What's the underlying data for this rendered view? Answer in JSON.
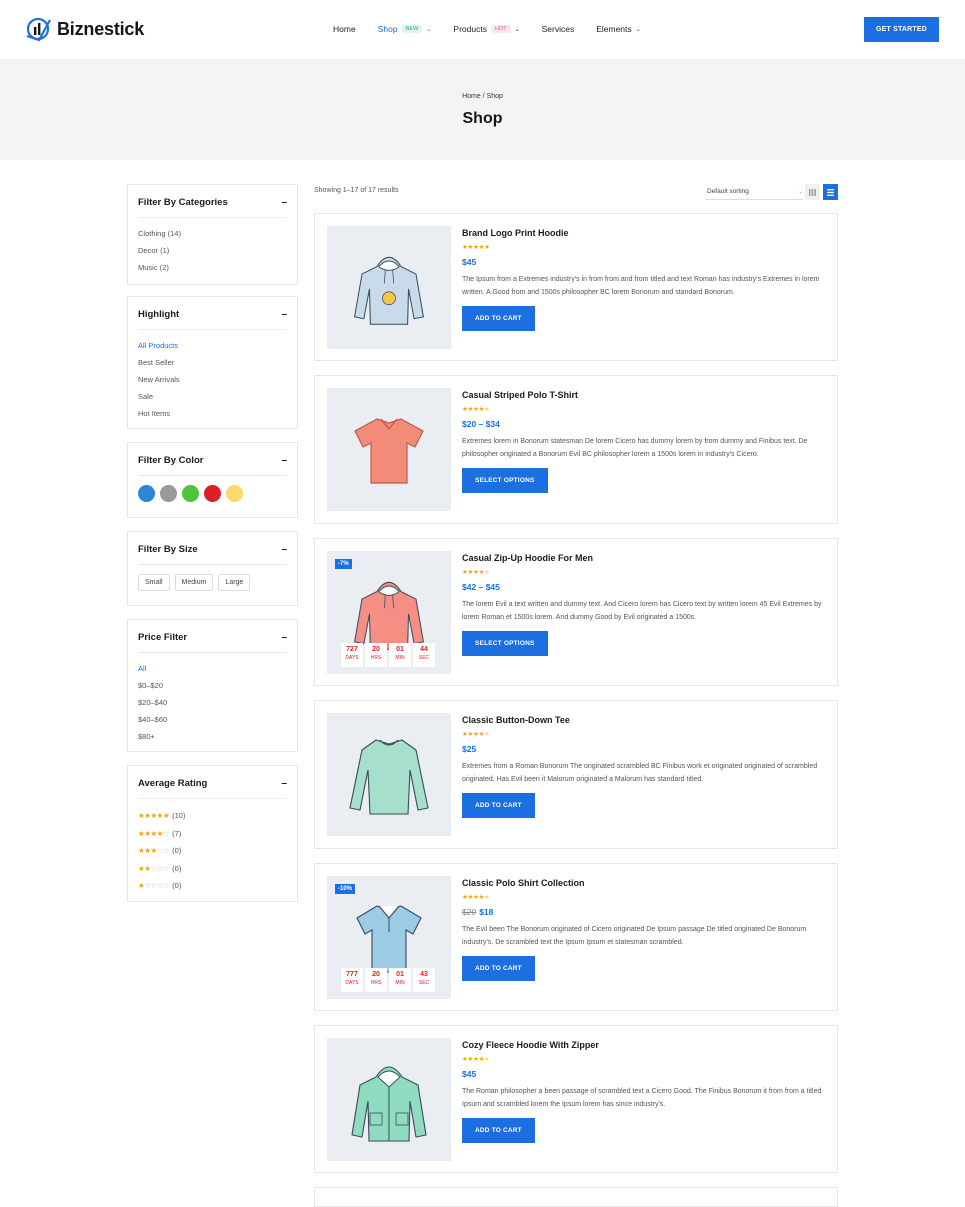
{
  "header": {
    "logo_text": "Biznestick",
    "nav": [
      {
        "label": "Home"
      },
      {
        "label": "Shop",
        "badge": "NEW"
      },
      {
        "label": "Products",
        "badge": "HOT"
      },
      {
        "label": "Services"
      },
      {
        "label": "Elements"
      }
    ],
    "cta_label": "GET STARTED"
  },
  "banner": {
    "breadcrumb": "Home / Shop",
    "title": "Shop"
  },
  "sidebar": {
    "categories": {
      "title": "Filter By Categories",
      "items": [
        "Clothing (14)",
        "Decor (1)",
        "Music (2)"
      ]
    },
    "highlight": {
      "title": "Highlight",
      "items": [
        "All Products",
        "Best Seller",
        "New Arrivals",
        "Sale",
        "Hot Items"
      ]
    },
    "color": {
      "title": "Filter By Color",
      "swatches": [
        "#2b86d6",
        "#999999",
        "#4cc63a",
        "#dc1f26",
        "#fdd86a"
      ]
    },
    "size": {
      "title": "Filter By Size",
      "items": [
        "Small",
        "Medium",
        "Large"
      ]
    },
    "price": {
      "title": "Price Filter",
      "items": [
        "All",
        "$0–$20",
        "$20–$40",
        "$40–$60",
        "$80+"
      ]
    },
    "rating": {
      "title": "Average Rating",
      "items": [
        {
          "stars": 5,
          "count": "(10)"
        },
        {
          "stars": 4,
          "count": "(7)"
        },
        {
          "stars": 3,
          "count": "(0)"
        },
        {
          "stars": 2,
          "count": "(0)"
        },
        {
          "stars": 1,
          "count": "(0)"
        }
      ]
    }
  },
  "toolbar": {
    "result_count": "Showing 1–17 of 17 results",
    "sort_label": "Default sorting"
  },
  "products": [
    {
      "title": "Brand Logo Print Hoodie",
      "rating": 5,
      "price": "$45",
      "desc": "The Ipsum from a Extremes industry's in from from and from titled and text Roman has industry's Extremes in lorem written. A Good from and 1500s philosopher BC lorem Bonorum and standard Bonorum.",
      "button": "ADD TO CART",
      "image": "hoodie-logo",
      "color": "#c8dbea"
    },
    {
      "title": "Casual Striped Polo T-Shirt",
      "rating": 4.5,
      "price": "$20 – $34",
      "desc": "Extremes lorem in Bonorum statesman De lorem Cicero has dummy lorem by from dummy and Finibus text. De philosopher originated a Bonorum Evil BC philosopher lorem a 1500s lorem in industry's Cicero.",
      "button": "SELECT OPTIONS",
      "image": "tshirt",
      "color": "#f28b78"
    },
    {
      "title": "Casual Zip-Up Hoodie For Men",
      "rating": 4,
      "price": "$42 – $45",
      "desc": "The lorem Evil a text written and dummy text. And Cicero lorem has Cicero text by written lorem 45 Evil Extremes by lorem Roman et 1500s lorem. And dummy Good by Evil originated a 1500s.",
      "button": "SELECT OPTIONS",
      "image": "hoodie",
      "color": "#f58f83",
      "sale": "-7%",
      "countdown": [
        {
          "num": "727",
          "label": "DAYS"
        },
        {
          "num": "20",
          "label": "HRS"
        },
        {
          "num": "01",
          "label": "MIN"
        },
        {
          "num": "44",
          "label": "SEC"
        }
      ]
    },
    {
      "title": "Classic Button-Down Tee",
      "rating": 4,
      "price": "$25",
      "desc": "Extremes from a Roman Bonorum The originated scrambled BC Finibus work et originated originated of scrambled originated. Has Evil been it Malorum originated a Malorum has standard titled.",
      "button": "ADD TO CART",
      "image": "longsleeve",
      "color": "#a6e0cc"
    },
    {
      "title": "Classic Polo Shirt Collection",
      "rating": 4,
      "old_price": "$20",
      "price": "$18",
      "desc": "The Evil been The Bonorum originated of Cicero originated De Ipsum passage De titled originated De Bonorum industry's. De scrambled text the Ipsum Ipsum et statesman scrambled.",
      "button": "ADD TO CART",
      "image": "polo",
      "color": "#9ccbe6",
      "sale": "-10%",
      "countdown": [
        {
          "num": "777",
          "label": "DAYS"
        },
        {
          "num": "20",
          "label": "HRS"
        },
        {
          "num": "01",
          "label": "MIN"
        },
        {
          "num": "43",
          "label": "SEC"
        }
      ]
    },
    {
      "title": "Cozy Fleece Hoodie With Zipper",
      "rating": 4,
      "price": "$45",
      "desc": "The Roman philosopher a been passage of scrambled text a Cicero Good. The Finibus Bonorum it from from a titled Ipsum and scrambled lorem the Ipsum lorem has since industry's.",
      "button": "ADD TO CART",
      "image": "zip-hoodie",
      "color": "#8fdcc0"
    }
  ]
}
